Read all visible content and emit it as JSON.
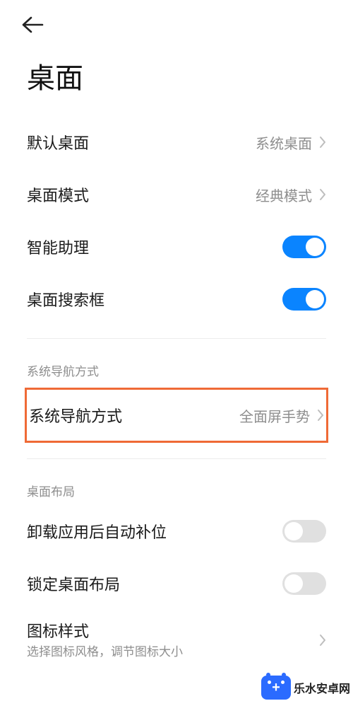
{
  "page": {
    "title": "桌面"
  },
  "rows": {
    "default_desktop": {
      "label": "默认桌面",
      "value": "系统桌面"
    },
    "desktop_mode": {
      "label": "桌面模式",
      "value": "经典模式"
    },
    "assistant": {
      "label": "智能助理",
      "on": true
    },
    "search_box": {
      "label": "桌面搜索框",
      "on": true
    }
  },
  "sections": {
    "navigation": {
      "header": "系统导航方式",
      "item": {
        "label": "系统导航方式",
        "value": "全面屏手势"
      }
    },
    "layout": {
      "header": "桌面布局",
      "auto_fill": {
        "label": "卸载应用后自动补位",
        "on": false
      },
      "lock_layout": {
        "label": "锁定桌面布局",
        "on": false
      },
      "icon_style": {
        "label": "图标样式",
        "sub": "选择图标风格，调节图标大小"
      }
    }
  },
  "watermark": "乐水安卓网"
}
